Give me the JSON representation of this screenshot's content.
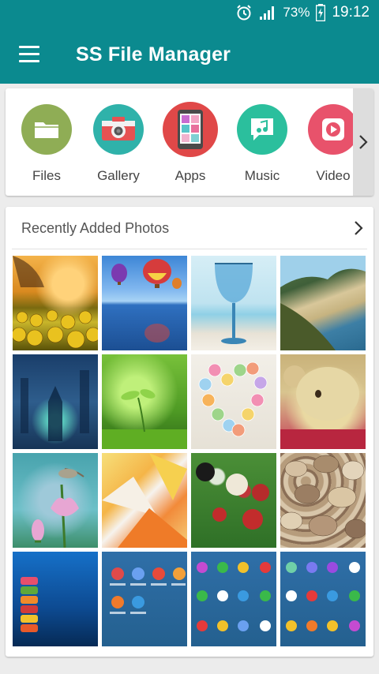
{
  "statusbar": {
    "battery": "73%",
    "time": "19:12"
  },
  "appbar": {
    "title": "SS File Manager"
  },
  "shortcuts": [
    {
      "label": "Files",
      "icon": "folder-icon",
      "color": "#8fad55"
    },
    {
      "label": "Gallery",
      "icon": "camera-icon",
      "color": "#2fb2aa"
    },
    {
      "label": "Apps",
      "icon": "apps-icon",
      "color": "#e04848"
    },
    {
      "label": "Music",
      "icon": "music-icon",
      "color": "#2bbf9d"
    },
    {
      "label": "Video",
      "icon": "video-icon",
      "color": "#e8526b"
    }
  ],
  "recent": {
    "title": "Recently Added Photos",
    "photos": [
      "sunflower-field",
      "hot-air-balloons",
      "blue-glass-beach",
      "coastline-cliffs",
      "blue-fantasy-city",
      "green-sprout",
      "candy-heart",
      "teddy-bear",
      "bird-on-flower",
      "candy-corn",
      "billiard-balls",
      "pebbles",
      "stacked-candies",
      "app-drawer-screenshot-1",
      "app-drawer-screenshot-2",
      "app-drawer-screenshot-3"
    ]
  },
  "colors": {
    "accent": "#0b8a8f",
    "background": "#ececec",
    "card": "#ffffff"
  }
}
